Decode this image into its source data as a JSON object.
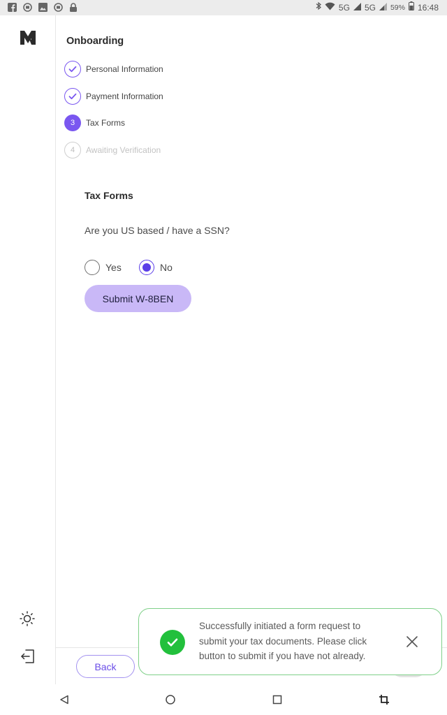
{
  "status_bar": {
    "left_icons": [
      "facebook-icon",
      "notification-icon",
      "image-icon",
      "notification-icon",
      "lock-icon"
    ],
    "network_1": "5G",
    "network_2": "5G",
    "battery": "59%",
    "time": "16:48"
  },
  "colors": {
    "accent": "#7a57f0",
    "radio": "#5b3ee8",
    "submit_bg": "#c9b8f7",
    "success": "#22c03c",
    "toast_border": "#7fd089"
  },
  "onboarding": {
    "title": "Onboarding",
    "steps": [
      {
        "label": "Personal Information",
        "state": "completed",
        "icon": "check-icon"
      },
      {
        "label": "Payment Information",
        "state": "completed",
        "icon": "check-icon"
      },
      {
        "label": "Tax Forms",
        "state": "active",
        "number": "3"
      },
      {
        "label": "Awaiting Verification",
        "state": "pending",
        "number": "4"
      }
    ]
  },
  "form": {
    "title": "Tax Forms",
    "question": "Are you US based / have a SSN?",
    "options": [
      {
        "label": "Yes",
        "selected": false
      },
      {
        "label": "No",
        "selected": true
      }
    ],
    "submit_label": "Submit W-8BEN"
  },
  "footer": {
    "back_label": "Back"
  },
  "toast": {
    "message": "Successfully initiated a form request to submit your tax documents. Please click button to submit if you have not already.",
    "icon": "check-circle-icon",
    "close_icon": "close-icon"
  },
  "sidebar": {
    "logo": "brand-logo",
    "theme_icon": "sun-icon",
    "logout_icon": "logout-icon"
  },
  "nav_bar": {
    "buttons": [
      "back-triangle-icon",
      "home-circle-icon",
      "recents-square-icon",
      "crop-icon"
    ]
  }
}
